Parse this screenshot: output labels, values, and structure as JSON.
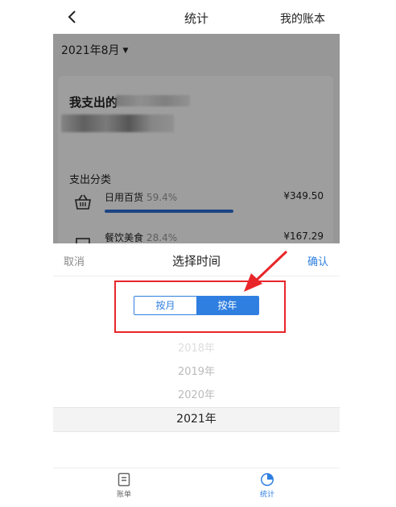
{
  "nav": {
    "title": "统计",
    "right_label": "我的账本"
  },
  "content": {
    "month": "2021年8月",
    "pay_title": "我支出的",
    "category_title": "支出分类",
    "categories": [
      {
        "name": "日用百货",
        "percent": "59.4%",
        "amount": "¥349.50",
        "progress": 0.594
      },
      {
        "name": "餐饮美食",
        "percent": "28.4%",
        "amount": "¥167.29",
        "progress": 0.284
      }
    ]
  },
  "sheet": {
    "cancel_label": "取消",
    "title": "选择时间",
    "confirm_label": "确认",
    "segments": {
      "by_month": "按月",
      "by_year": "按年",
      "active": "by_year"
    },
    "years": [
      "2018年",
      "2019年",
      "2020年",
      "2021年"
    ],
    "selected_year": "2021年"
  },
  "tabbar": {
    "bill_label": "账单",
    "stats_label": "统计",
    "active_color": "#2f7fe0",
    "inactive_color": "#666666"
  },
  "colors": {
    "accent": "#2f7fe0",
    "annotation": "#e8262a",
    "progress": "#2f6fd6"
  }
}
